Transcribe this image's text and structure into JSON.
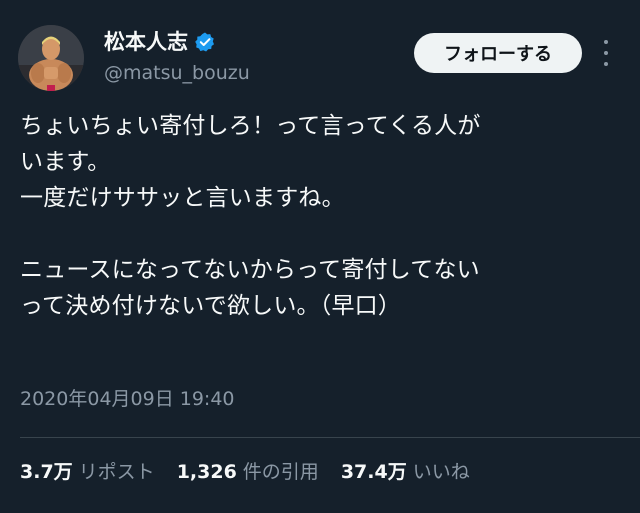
{
  "author": {
    "display_name": "松本人志",
    "handle": "@matsu_bouzu",
    "verified_icon": "verified-badge-icon",
    "avatar_icon": "avatar-image"
  },
  "actions": {
    "follow_label": "フォローする",
    "more_icon": "more-dots-icon"
  },
  "tweet": {
    "text": "ちょいちょい寄付しろ！って言ってくる人が\nいます。\n一度だけササッと言いますね。\n\nニュースになってないからって寄付してない\nって決め付けないで欲しい。（早口）",
    "timestamp": "2020年04月09日 19:40"
  },
  "stats": [
    {
      "value": "3.7万",
      "label": "リポスト"
    },
    {
      "value": "1,326",
      "label": "件の引用"
    },
    {
      "value": "37.4万",
      "label": "いいね"
    }
  ],
  "colors": {
    "background": "#15202b",
    "text": "#f7f9f9",
    "secondary": "#8b98a5",
    "verified": "#1d9bf0",
    "button_bg": "#eff3f4"
  }
}
